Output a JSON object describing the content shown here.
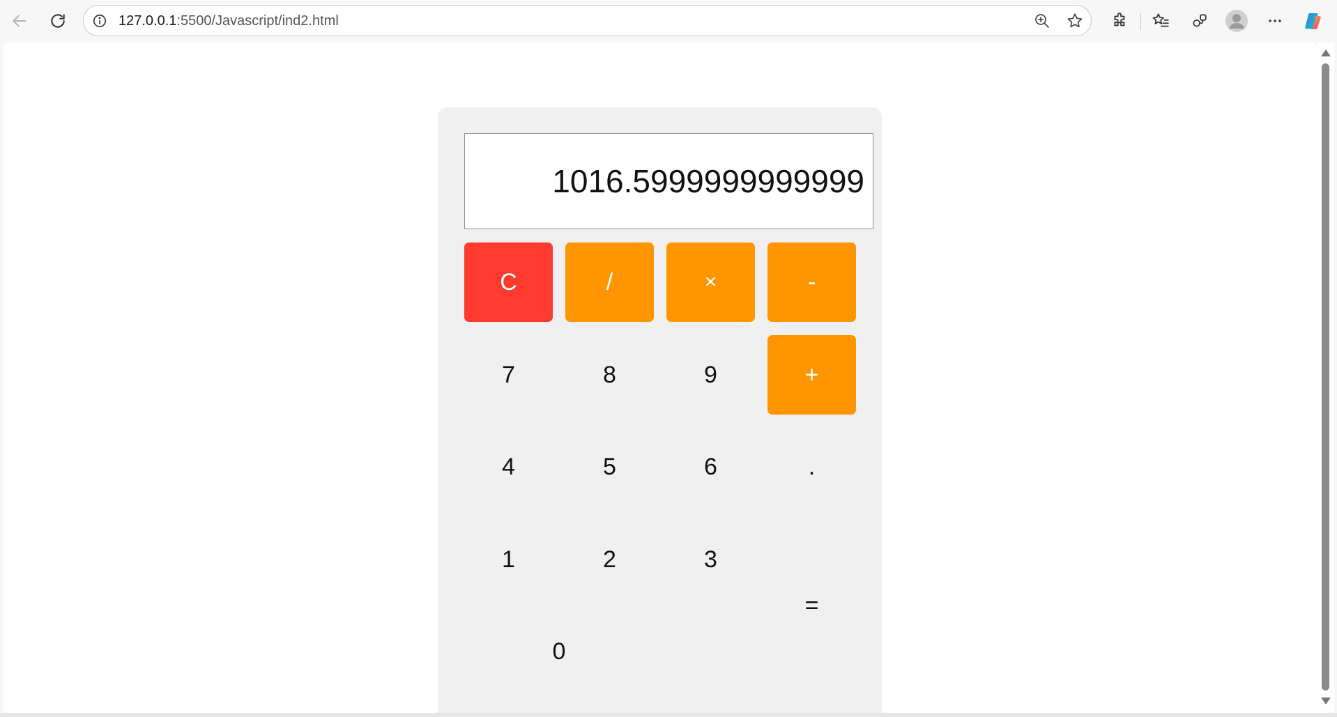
{
  "browser": {
    "url_host": "127.0.0.1",
    "url_rest": ":5500/Javascript/ind2.html"
  },
  "calculator": {
    "display_value": "1016.5999999999999",
    "keys": {
      "clear": "C",
      "divide": "/",
      "multiply": "×",
      "subtract": "-",
      "seven": "7",
      "eight": "8",
      "nine": "9",
      "add": "+",
      "four": "4",
      "five": "5",
      "six": "6",
      "decimal": ".",
      "one": "1",
      "two": "2",
      "three": "3",
      "equals": "=",
      "zero": "0"
    }
  },
  "colors": {
    "clear_key": "#ff3b30",
    "operator_key": "#ff9500",
    "calculator_bg": "#f0f0f0"
  }
}
